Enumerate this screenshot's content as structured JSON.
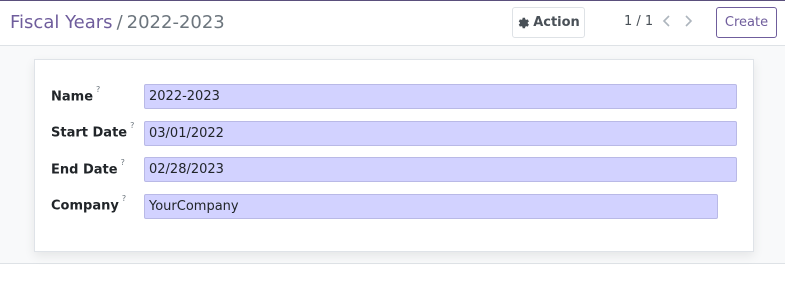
{
  "breadcrumb": {
    "parent": "Fiscal Years",
    "separator": "/",
    "current": "2022-2023"
  },
  "toolbar": {
    "action_label": "Action",
    "pager_text": "1 / 1",
    "create_label": "Create"
  },
  "form": {
    "fields": [
      {
        "label": "Name",
        "help": "?",
        "value": "2022-2023"
      },
      {
        "label": "Start Date",
        "help": "?",
        "value": "03/01/2022"
      },
      {
        "label": "End Date",
        "help": "?",
        "value": "02/28/2023"
      },
      {
        "label": "Company",
        "help": "?",
        "value": "YourCompany"
      }
    ]
  },
  "colors": {
    "brand": "#6f5d9c",
    "required_field_bg": "#d2d2ff"
  },
  "icons": [
    "gear-icon",
    "chevron-left-icon",
    "chevron-right-icon"
  ]
}
